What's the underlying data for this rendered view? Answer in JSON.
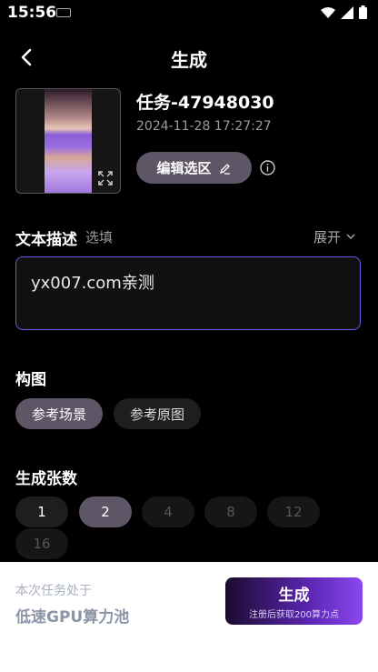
{
  "status": {
    "time": "15:56"
  },
  "header": {
    "title": "生成"
  },
  "task": {
    "title": "任务-47948030",
    "time": "2024-11-28 17:27:27",
    "edit_label": "编辑选区"
  },
  "description": {
    "label": "文本描述",
    "optional": "选填",
    "expand": "展开",
    "text": "yx007.com亲测"
  },
  "composition": {
    "label": "构图",
    "options": [
      "参考场景",
      "参考原图"
    ],
    "selected": "参考场景"
  },
  "count": {
    "label": "生成张数",
    "options": [
      "1",
      "2",
      "4",
      "8",
      "12",
      "16"
    ],
    "selected": "2",
    "disabled": [
      "4",
      "8",
      "12",
      "16"
    ]
  },
  "footer": {
    "line1": "本次任务处于",
    "line2": "低速GPU算力池",
    "button_label": "生成",
    "button_sub": "注册后获取200算力点"
  },
  "colors": {
    "accent": "#7c54e0",
    "pill_active": "#5e5666"
  }
}
